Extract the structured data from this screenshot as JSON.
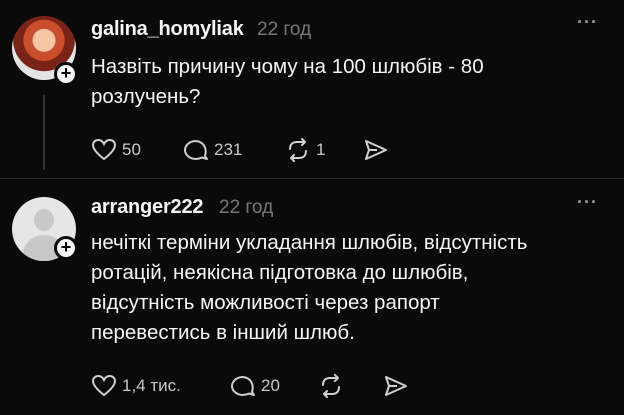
{
  "posts": [
    {
      "username": "galina_homyliak",
      "time": "22 год",
      "lines": [
        "Назвіть причину чому на 100 шлюбів - 80",
        "розлучень?"
      ],
      "likes": "50",
      "comments": "231",
      "reposts": "1"
    },
    {
      "username": "arranger222",
      "time": "22 год",
      "lines": [
        "нечіткі терміни укладання шлюбів, відсутність",
        "ротацій, неякісна підготовка до шлюбів,",
        "відсутність можливості через рапорт",
        "перевестись в інший шлюб."
      ],
      "likes": "1,4 тис.",
      "comments": "20"
    }
  ],
  "more_label": "···",
  "icons": [
    "heart-icon",
    "comment-icon",
    "repost-icon",
    "share-icon",
    "plus-icon",
    "more-icon"
  ],
  "colors": {
    "background": "#0a0a0a",
    "text": "#f3f5f7",
    "muted": "#777777"
  }
}
